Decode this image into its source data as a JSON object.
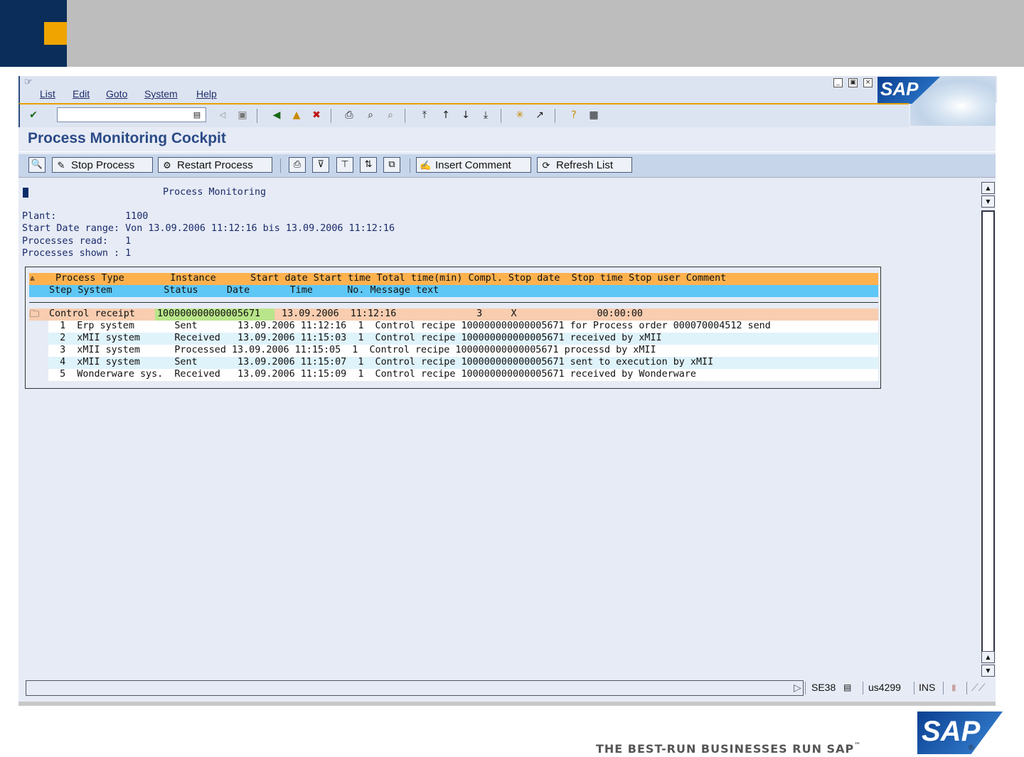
{
  "menu": [
    "List",
    "Edit",
    "Goto",
    "System",
    "Help"
  ],
  "brand": "SAP",
  "window_controls": {
    "minimize": "_",
    "restore": "▣",
    "close": "×"
  },
  "page_title": "Process Monitoring Cockpit",
  "app_toolbar": {
    "stop_process": "Stop Process",
    "restart_process": "Restart Process",
    "insert_comment": "Insert Comment",
    "refresh_list": "Refresh List"
  },
  "report": {
    "heading": "Process Monitoring",
    "lines": [
      "Plant:            1100",
      "Start Date range: Von 13.09.2006 11:12:16 bis 13.09.2006 11:12:16",
      "Processes read:   1",
      "Processes shown : 1"
    ]
  },
  "table": {
    "header1": "Process Type        Instance      Start date Start time Total time(min) Compl. Stop date  Stop time Stop user Comment",
    "header2": "Step System         Status     Date       Time      No. Message text",
    "group": {
      "process_type": "Control receipt",
      "instance": "100000000000005671",
      "rest": " 13.09.2006  11:12:16              3     X              00:00:00"
    },
    "steps": [
      "  1  Erp system       Sent       13.09.2006 11:12:16  1  Control recipe 100000000000005671 for Process order 000070004512 send",
      "  2  xMII system      Received   13.09.2006 11:15:03  1  Control recipe 100000000000005671 received by xMII",
      "  3  xMII system      Processed 13.09.2006 11:15:05  1  Control recipe 100000000000005671 processd by xMII",
      "  4  xMII system      Sent       13.09.2006 11:15:07  1  Control recipe 100000000000005671 sent to execution by xMII",
      "  5  Wonderware sys.  Received   13.09.2006 11:15:09  1  Control recipe 100000000000005671 received by Wonderware"
    ],
    "step_colors": [
      "#ffffff",
      "#dff3fb",
      "#ffffff",
      "#dff3fb",
      "#ffffff"
    ]
  },
  "status_bar": {
    "transaction": "SE38",
    "server": "us4299",
    "mode": "INS"
  },
  "footer": {
    "tagline": "THE BEST-RUN BUSINESSES RUN SAP",
    "tm": "™",
    "logo": "SAP",
    "registered": "®"
  },
  "colors": {
    "header_navy": "#0a2d5a",
    "header_orange": "#f0a400",
    "table_header_orange": "#ffb14e",
    "table_header_blue": "#5ec7f5",
    "group_row": "#f8cdb0",
    "instance_highlight": "#b9e58a"
  }
}
